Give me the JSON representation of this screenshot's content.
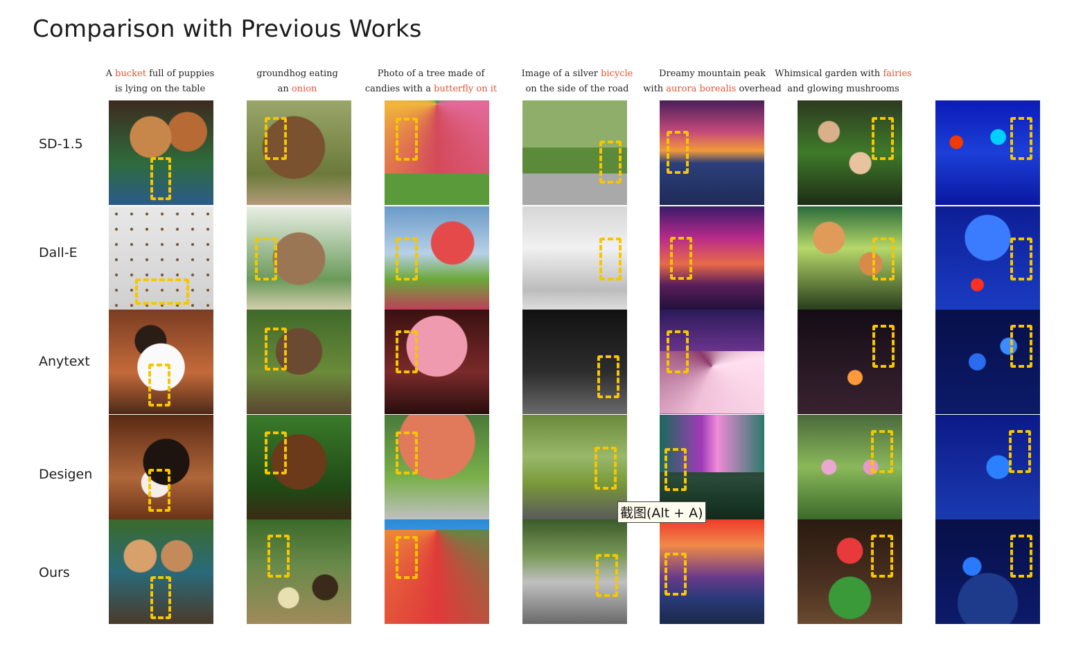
{
  "title": "Comparison with Previous Works",
  "captions": [
    {
      "parts": [
        {
          "t": "A ",
          "h": false
        },
        {
          "t": "bucket",
          "h": true
        },
        {
          "t": " full of puppies",
          "h": false
        }
      ],
      "line2": [
        {
          "t": "is lying on the table",
          "h": false
        }
      ]
    },
    {
      "parts": [
        {
          "t": "groundhog eating",
          "h": false
        }
      ],
      "line2": [
        {
          "t": "an ",
          "h": false
        },
        {
          "t": "onion",
          "h": true
        }
      ]
    },
    {
      "parts": [
        {
          "t": "Photo of a tree made of",
          "h": false
        }
      ],
      "line2": [
        {
          "t": "candies with a ",
          "h": false
        },
        {
          "t": "butterfly on it",
          "h": true
        }
      ]
    },
    {
      "parts": [
        {
          "t": "Image of a silver ",
          "h": false
        },
        {
          "t": "bicycle",
          "h": true
        }
      ],
      "line2": [
        {
          "t": "on the side of the road",
          "h": false
        }
      ]
    },
    {
      "parts": [
        {
          "t": "Dreamy mountain peak",
          "h": false
        }
      ],
      "line2": [
        {
          "t": "with ",
          "h": false
        },
        {
          "t": "aurora borealis",
          "h": true
        },
        {
          "t": " overhead",
          "h": false
        }
      ]
    },
    {
      "parts": [
        {
          "t": "Whimsical garden with ",
          "h": false
        },
        {
          "t": "fairies",
          "h": true
        }
      ],
      "line2": [
        {
          "t": "and glowing mushrooms",
          "h": false
        }
      ]
    }
  ],
  "rows": [
    "SD-1.5",
    "Dall-E",
    "Anytext",
    "Desigen",
    "Ours"
  ],
  "tooltip": "截图(Alt + A)",
  "colors": {
    "highlight": "#e8522f",
    "box": "#f7c600"
  }
}
